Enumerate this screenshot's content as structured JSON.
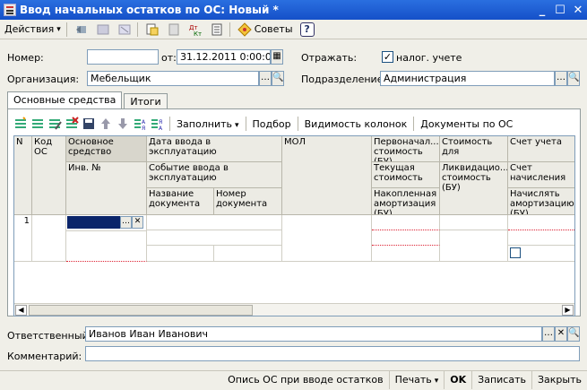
{
  "window": {
    "title": "Ввод начальных остатков по ОС: Новый *"
  },
  "toolbar": {
    "actions_label": "Действия",
    "tips_label": "Советы",
    "help_label": "?"
  },
  "header": {
    "number_label": "Номер:",
    "number_value": "",
    "from_label": "от:",
    "date_value": "31.12.2011  0:00:00",
    "reflect_label": "Отражать:",
    "tax_accounting_label": "налог. учете",
    "tax_accounting_checked": true,
    "organization_label": "Организация:",
    "organization_value": "Мебельщик",
    "department_label": "Подразделение:",
    "department_value": "Администрация"
  },
  "tabs": [
    {
      "label": "Основные средства",
      "active": true
    },
    {
      "label": "Итоги",
      "active": false
    }
  ],
  "table_toolbar": {
    "fill_label": "Заполнить",
    "pick_label": "Подбор",
    "columns_label": "Видимость колонок",
    "docs_label": "Документы по ОС"
  },
  "table": {
    "headers": {
      "n": "N",
      "code": "Код ОС",
      "asset": "Основное средство",
      "inv_no": "Инв. №",
      "date_in": "Дата ввода в эксплуатацию",
      "event": "Событие ввода в эксплуатацию",
      "doc_name": "Название документа",
      "doc_number": "Номер документа",
      "mol": "МОЛ",
      "initial_cost": "Первоначал... стоимость (БУ)",
      "current_cost": "Текущая стоимость",
      "accum_amort": "Накопленная амортизация (БУ)",
      "cost_for": "Стоимость для",
      "liquid_cost": "Ликвидацио... стоимость (БУ)",
      "account": "Счет учета",
      "acc_accrual": "Счет начисления",
      "accrue_amort": "Начислять амортизацию (БУ)"
    },
    "rows": [
      {
        "n": "1"
      }
    ]
  },
  "footer": {
    "responsible_label": "Ответственный:",
    "responsible_value": "Иванов Иван Иванович",
    "comment_label": "Комментарий:",
    "comment_value": ""
  },
  "statusbar": {
    "inventory": "Опись ОС при вводе остатков",
    "print": "Печать",
    "ok": "OK",
    "save": "Записать",
    "close": "Закрыть"
  }
}
